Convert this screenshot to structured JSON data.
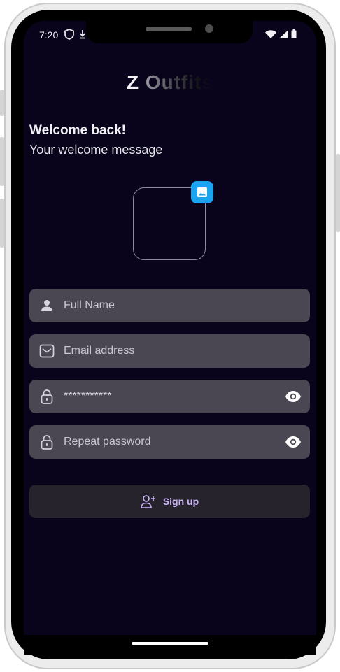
{
  "status_bar": {
    "time": "7:20",
    "left_icons": [
      "shield-icon",
      "download-icon"
    ],
    "right_icons": [
      "wifi-icon",
      "signal-icon",
      "battery-icon"
    ]
  },
  "app": {
    "title_first": "Z",
    "title_rest": "Outfits"
  },
  "welcome": {
    "title": "Welcome back!",
    "subtitle": "Your welcome message"
  },
  "avatar": {
    "badge_icon": "image-icon"
  },
  "form": {
    "full_name": {
      "placeholder": "Full Name",
      "value": "",
      "icon": "person-icon"
    },
    "email": {
      "placeholder": "Email address",
      "value": "",
      "icon": "mail-icon"
    },
    "password": {
      "placeholder": "",
      "value": "***********",
      "icon": "lock-icon",
      "toggle_icon": "eye-icon"
    },
    "repeat_password": {
      "placeholder": "Repeat password",
      "value": "",
      "icon": "lock-icon",
      "toggle_icon": "eye-icon"
    }
  },
  "signup": {
    "label": "Sign up",
    "icon": "add-user-icon"
  },
  "colors": {
    "background": "#09041c",
    "field": "#4a4652",
    "button": "#26232d",
    "accent": "#cbb5f5",
    "badge": "#1aa3ef"
  }
}
